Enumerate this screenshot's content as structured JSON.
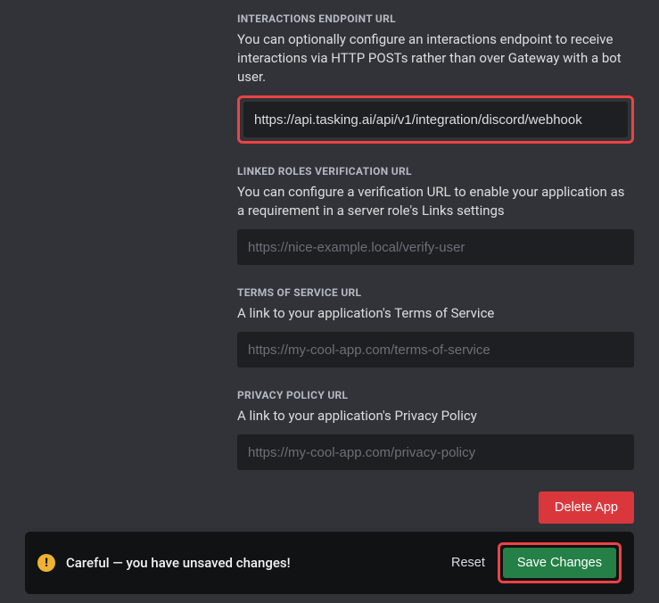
{
  "sections": {
    "interactions": {
      "label": "INTERACTIONS ENDPOINT URL",
      "desc": "You can optionally configure an interactions endpoint to receive interactions via HTTP POSTs rather than over Gateway with a bot user.",
      "value": "https://api.tasking.ai/api/v1/integration/discord/webhook"
    },
    "linkedRoles": {
      "label": "LINKED ROLES VERIFICATION URL",
      "desc": "You can configure a verification URL to enable your application as a requirement in a server role's Links settings",
      "placeholder": "https://nice-example.local/verify-user"
    },
    "tos": {
      "label": "TERMS OF SERVICE URL",
      "desc": "A link to your application's Terms of Service",
      "placeholder": "https://my-cool-app.com/terms-of-service"
    },
    "privacy": {
      "label": "PRIVACY POLICY URL",
      "desc": "A link to your application's Privacy Policy",
      "placeholder": "https://my-cool-app.com/privacy-policy"
    }
  },
  "buttons": {
    "delete": "Delete App",
    "reset": "Reset",
    "save": "Save Changes"
  },
  "toast": {
    "message": "Careful — you have unsaved changes!",
    "iconMark": "!"
  }
}
